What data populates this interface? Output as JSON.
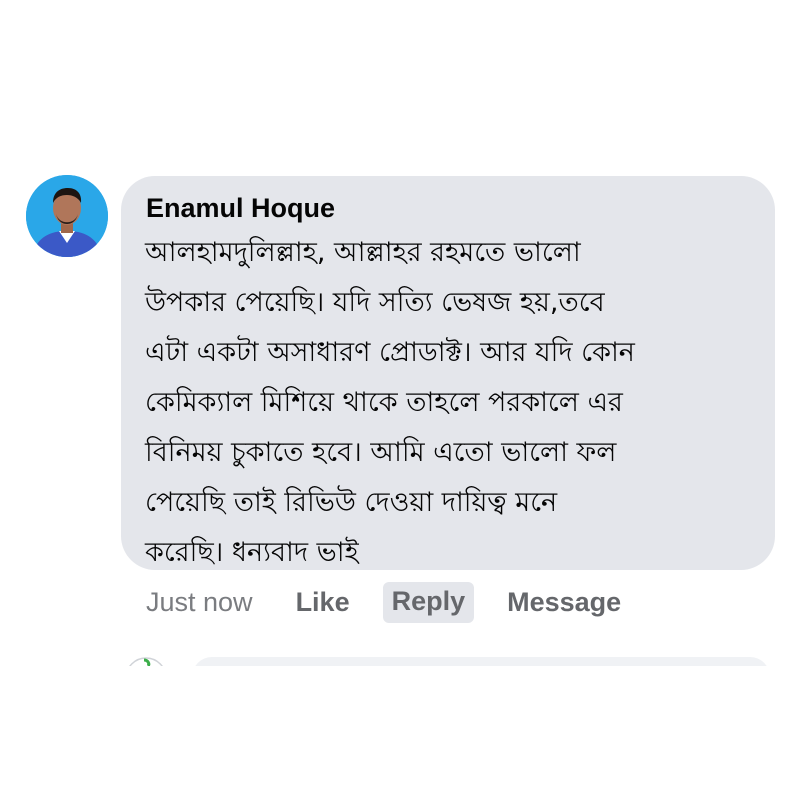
{
  "comment": {
    "author": "Enamul Hoque",
    "lines": [
      "আলহামদুলিল্লাহ, আল্লাহর রহমতে ভালো",
      "উপকার পেয়েছি। যদি সত্যি ভেষজ হয়,তবে",
      "এটা একটা অসাধারণ প্রোডাক্ট। আর যদি কোন",
      "কেমিক্যাল মিশিয়ে থাকে তাহলে পরকালে এর",
      "বিনিময় চুকাতে হবে। আমি এতো ভালো ফল",
      "পেয়েছি তাই রিভিউ দেওয়া দায়িত্ব মনে",
      "করেছি। ধন্যবাদ ভাই"
    ]
  },
  "actions": {
    "timestamp": "Just now",
    "like": "Like",
    "reply": "Reply",
    "message": "Message"
  },
  "colors": {
    "bubble_bg": "#e4e6eb",
    "text": "#050505",
    "action_text": "#65676b",
    "avatar_bg": "#2aa7e8"
  }
}
